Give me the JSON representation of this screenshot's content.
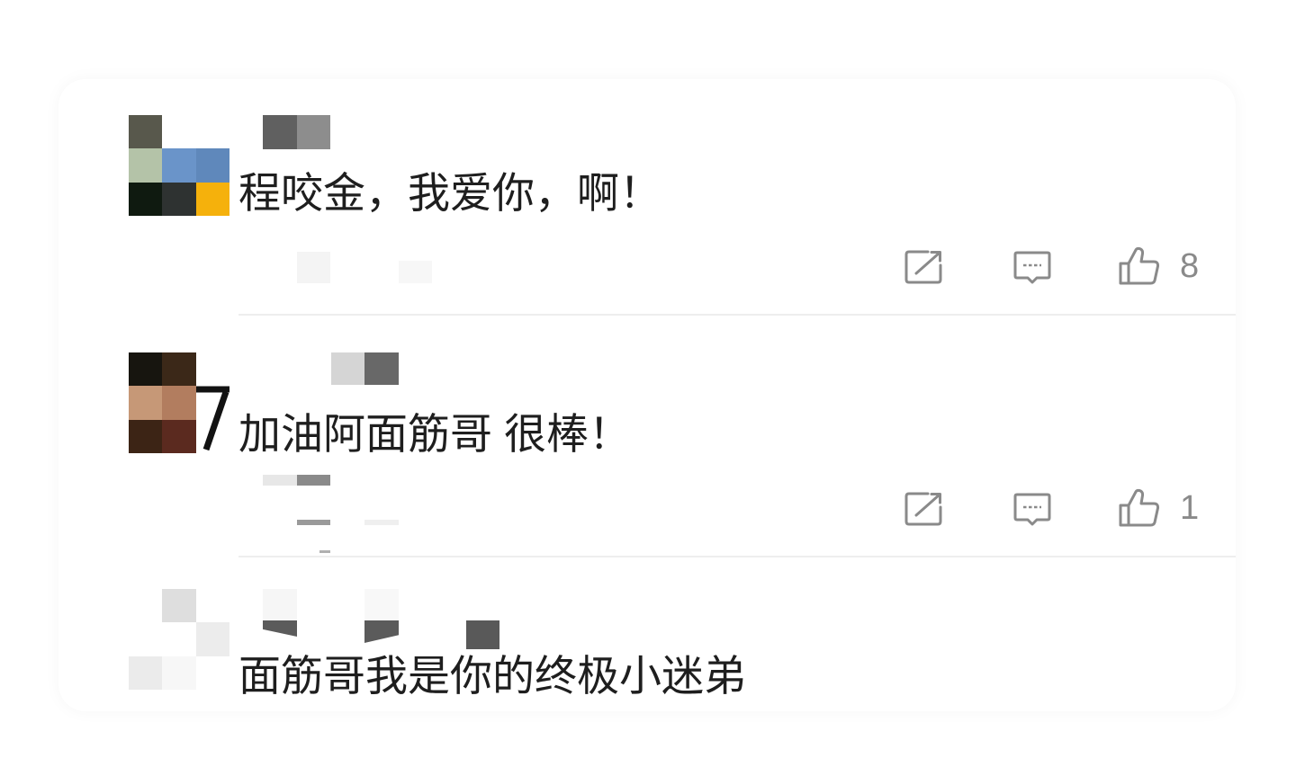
{
  "colors": {
    "comment_text": "#1e1e1e",
    "action_icon": "#8a8a8a",
    "divider": "#eeeeee"
  },
  "icons": {
    "share": "share-icon",
    "reply": "comment-icon",
    "like": "thumbs-up-icon"
  },
  "comments": [
    {
      "text": "程咬金，我爱你，啊！",
      "like_count": "8",
      "avatar_mosaic": [
        [
          "#58584c",
          "#ffffff",
          "#ffffff"
        ],
        [
          "#b4c3a8",
          "#6a94c9",
          "#5f88bb"
        ],
        [
          "#0f1a10",
          "#2e3231",
          "#f5b10c"
        ]
      ]
    },
    {
      "text": "加油阿面筋哥 很棒！",
      "like_count": "1",
      "avatar_mosaic": [
        [
          "#17150f",
          "#3b2818",
          "#ffffff"
        ],
        [
          "#c69877",
          "#b27d5f",
          "#ffffff"
        ],
        [
          "#3c2415",
          "#5b2a1f",
          "#ffffff"
        ]
      ]
    },
    {
      "text": "面筋哥我是你的终极小迷弟",
      "avatar_mosaic": [
        [
          "#ffffff",
          "#dedede",
          "#ffffff"
        ],
        [
          "#ffffff",
          "#ffffff",
          "#ececec"
        ],
        [
          "#ebebeb",
          "#f7f7f7",
          "#ffffff"
        ]
      ]
    }
  ]
}
